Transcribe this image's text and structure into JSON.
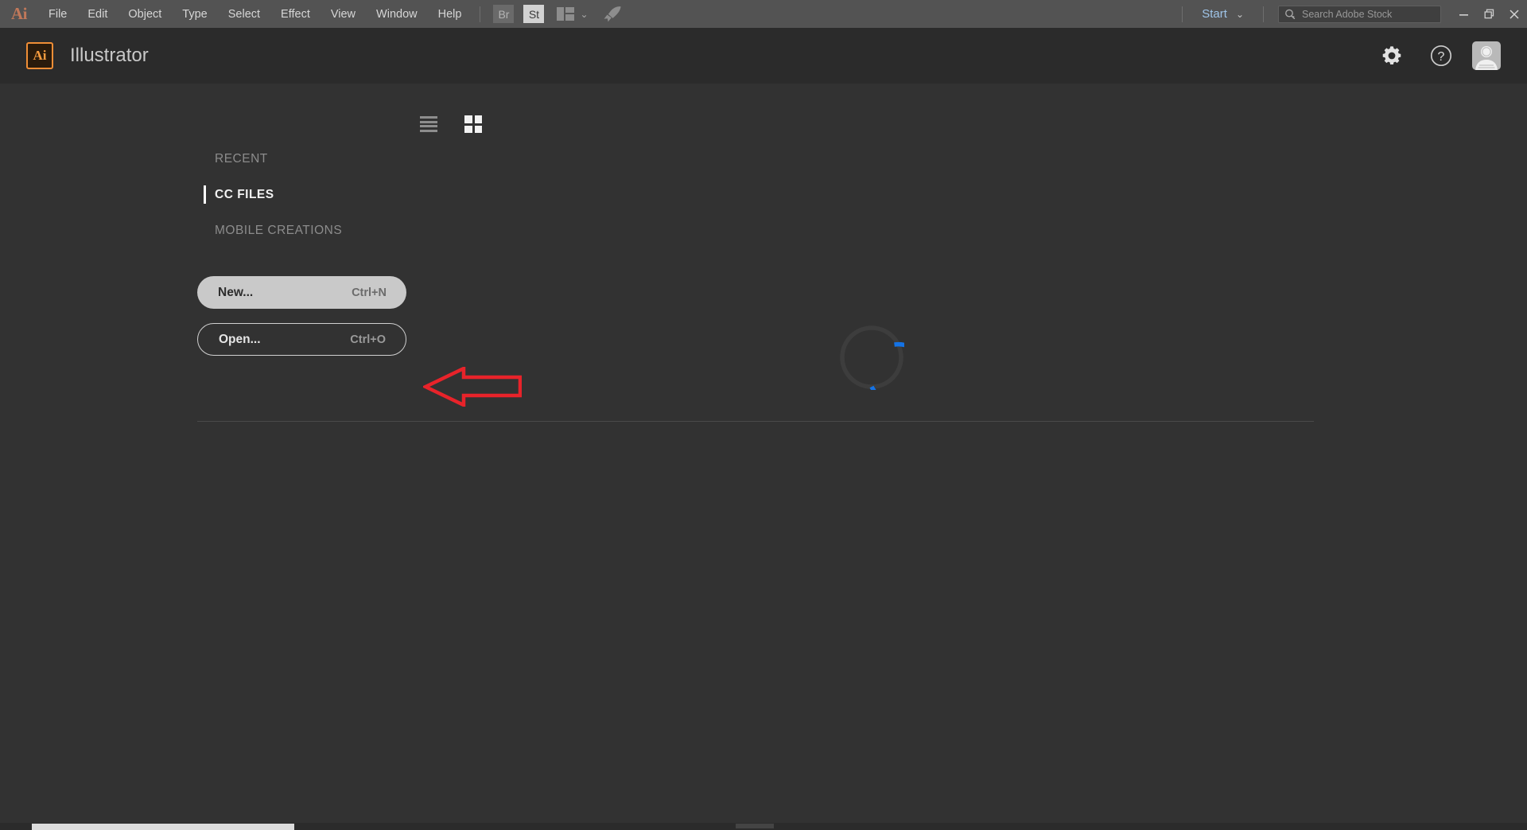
{
  "menubar": {
    "logo": "Ai",
    "items": [
      {
        "label": "File"
      },
      {
        "label": "Edit"
      },
      {
        "label": "Object"
      },
      {
        "label": "Type"
      },
      {
        "label": "Select"
      },
      {
        "label": "Effect"
      },
      {
        "label": "View"
      },
      {
        "label": "Window"
      },
      {
        "label": "Help"
      }
    ],
    "bridge_label": "Br",
    "stock_label": "St",
    "workspace_icon": "workspace-layout-icon",
    "workspace_chevron": "⌄",
    "rocket_icon": "rocket-icon",
    "start_label": "Start",
    "start_chevron": "⌄",
    "search": {
      "icon": "search-icon",
      "placeholder": "Search Adobe Stock",
      "value": ""
    },
    "window_controls": {
      "minimize": "minimize-icon",
      "restore": "restore-icon",
      "close": "close-icon"
    }
  },
  "appheader": {
    "badge": "Ai",
    "title": "Illustrator",
    "settings_icon": "gear-icon",
    "help_icon": "help-question-icon",
    "avatar_icon": "user-avatar-icon"
  },
  "content": {
    "view_toggles": [
      {
        "name": "list-view-toggle",
        "icon": "list-view-icon",
        "active": false
      },
      {
        "name": "grid-view-toggle",
        "icon": "grid-view-icon",
        "active": true
      }
    ],
    "nav": [
      {
        "label": "RECENT",
        "active": false
      },
      {
        "label": "CC FILES",
        "active": true
      },
      {
        "label": "MOBILE CREATIONS",
        "active": false
      }
    ],
    "buttons": [
      {
        "name": "New...",
        "keys": "Ctrl+N",
        "style": "filled"
      },
      {
        "name": "Open...",
        "keys": "Ctrl+O",
        "style": "outline"
      }
    ],
    "annotation": {
      "shape": "left-pointing-arrow",
      "color": "#e8232a"
    },
    "loading": {
      "label": "loading-spinner",
      "arc_color": "#1473e6",
      "track_color": "#3d3d3d",
      "progress_fraction": 0.75
    }
  },
  "colors": {
    "menubar_bg": "#535353",
    "header_bg": "#2b2b2b",
    "canvas_bg": "#323232",
    "accent_orange": "#f08e36",
    "accent_blue": "#1473e6",
    "annotation_red": "#e8232a"
  }
}
